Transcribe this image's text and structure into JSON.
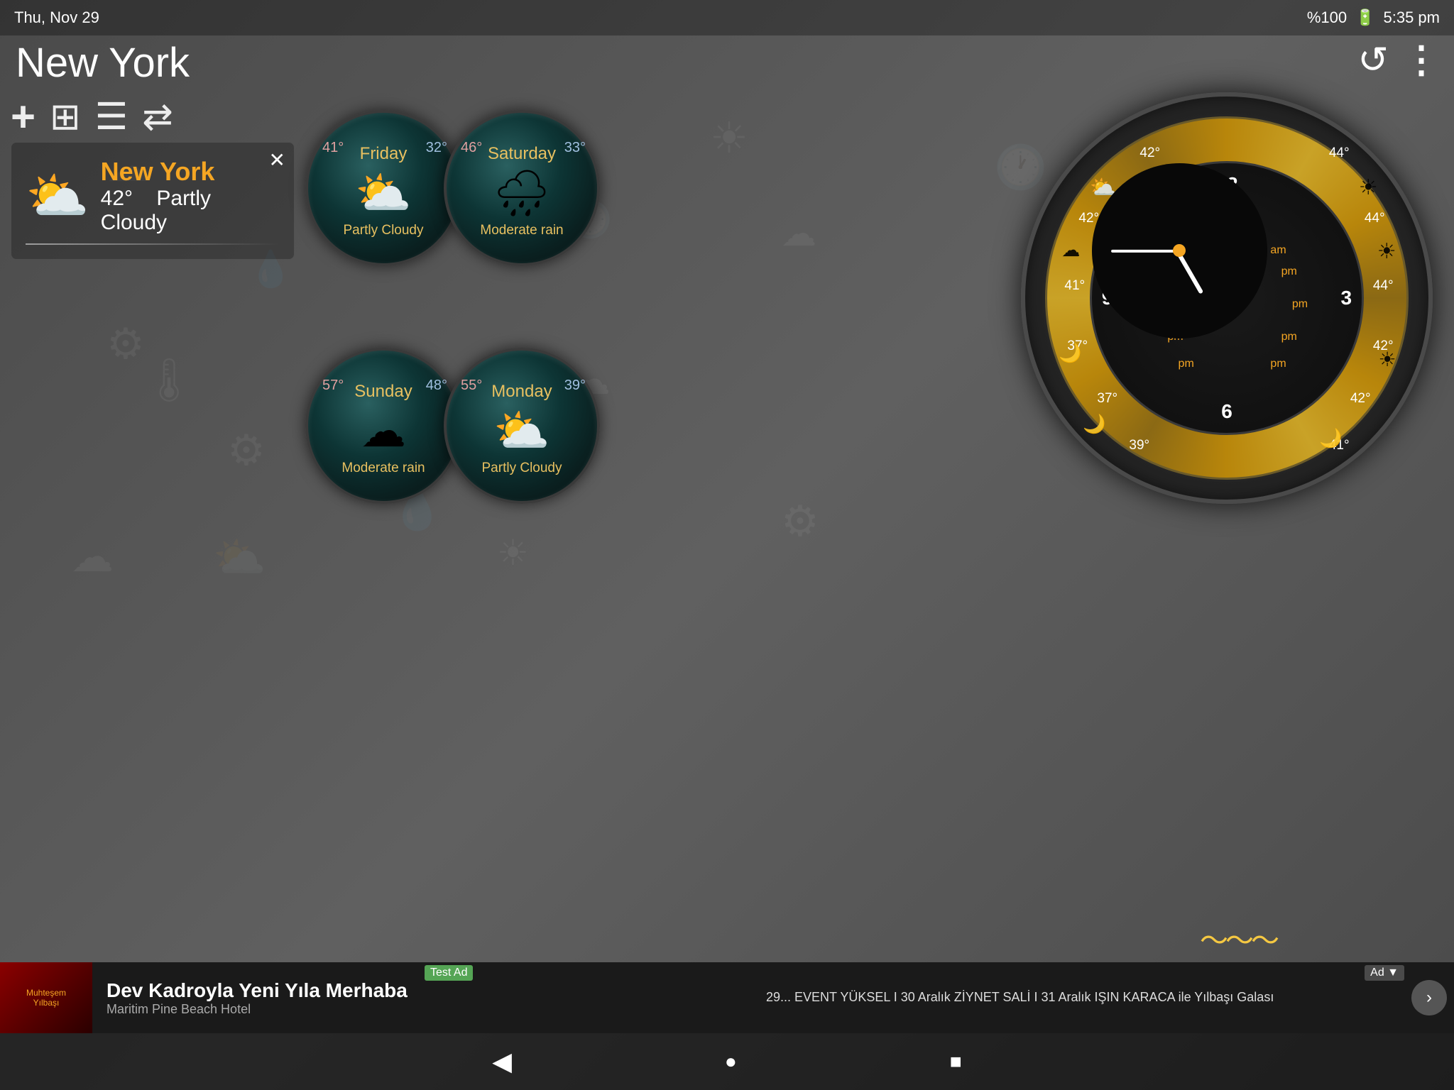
{
  "statusBar": {
    "date": "Thu, Nov 29",
    "battery": "%100",
    "time": "5:35 pm"
  },
  "cityTitle": "New York",
  "toolbar": {
    "addBtn": "+",
    "icons": [
      "⊞",
      "☰",
      "⇄"
    ]
  },
  "currentWeather": {
    "city": "New York",
    "temp": "42°",
    "condition": "Partly Cloudy"
  },
  "forecast": [
    {
      "day": "Friday",
      "high": "41°",
      "low": "32°",
      "condition": "Partly Cloudy",
      "icon": "⛅"
    },
    {
      "day": "Saturday",
      "high": "46°",
      "low": "33°",
      "condition": "Moderate rain",
      "icon": "🌧"
    },
    {
      "day": "Sunday",
      "high": "57°",
      "low": "48°",
      "condition": "Moderate rain",
      "icon": "☁"
    },
    {
      "day": "Monday",
      "high": "55°",
      "low": "39°",
      "condition": "Partly Cloudy",
      "icon": "⛅"
    }
  ],
  "clock": {
    "hours": [
      "12",
      "3",
      "6",
      "9"
    ],
    "tempLabels": {
      "top_left": "42°",
      "top_right": "44°",
      "mid_left": "41°",
      "mid_right": "44°",
      "center_left": "37°",
      "center_right": "42°",
      "bot_left": "37°",
      "bot_right": "42°",
      "bot_mid_left": "39°",
      "bot_mid_right": "41°"
    }
  },
  "pageIndicators": [
    "●",
    "●",
    "●"
  ],
  "waveLabel": "〜〜〜",
  "bottomNav": {
    "back": "◀",
    "home": "●",
    "square": "■"
  },
  "ad": {
    "mainText": "Dev Kadroyla Yeni Yıla Merhaba",
    "subText": "Maritim Pine Beach Hotel",
    "rightText": "29... EVENT YÜKSEL I 30 Aralık ZİYNET SALİ I 31 Aralık IŞIN KARACA ile Yılbaşı Galası",
    "testBadge": "Test Ad",
    "adLabel": "Ad ▼"
  },
  "buttons": {
    "refresh": "↺",
    "menu": "⋮"
  }
}
